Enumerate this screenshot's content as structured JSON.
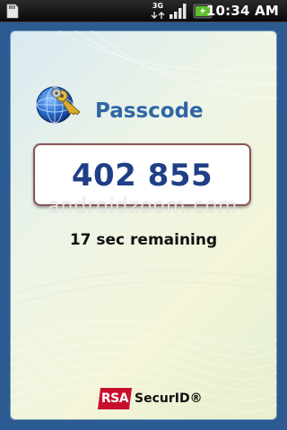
{
  "status_bar": {
    "time": "10:34 AM",
    "network_type": "3G",
    "icons": [
      "sd-card-icon",
      "3g-icon",
      "signal-icon",
      "battery-icon"
    ]
  },
  "app": {
    "title": "Passcode",
    "passcode": "402 855",
    "timer_text": "17 sec remaining",
    "watermark": "androidzoom.com",
    "brand": {
      "rsa": "RSA",
      "securid": "SecurID®"
    },
    "logo_icon": "globe-key-icon"
  },
  "colors": {
    "app_background": "#2b5b90",
    "title": "#2f66a6",
    "passcode_text": "#1f3f86",
    "passcode_border": "#8a5656",
    "rsa_red": "#c8102e"
  }
}
